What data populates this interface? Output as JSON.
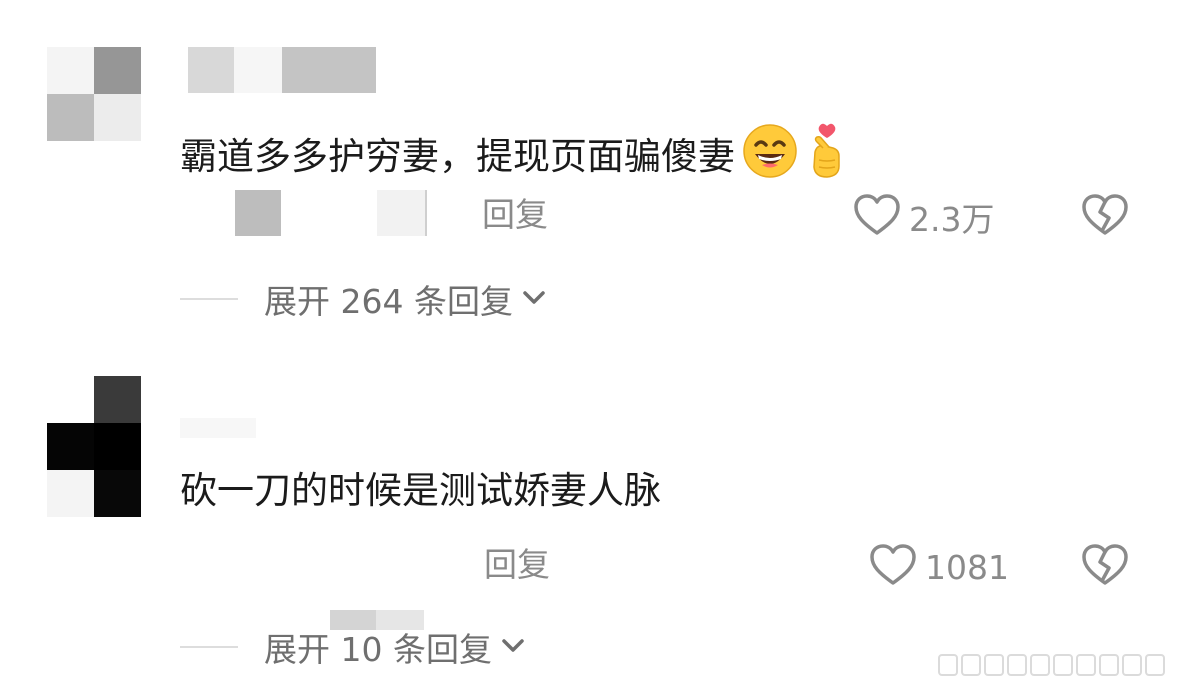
{
  "comments": [
    {
      "text": "霸道多多护穷妻，提现页面骗傻妻",
      "emojis": [
        "grinning-face-icon",
        "finger-heart-icon"
      ],
      "reply_label": "回复",
      "like_count": "2.3万",
      "expand_label": "展开 264 条回复"
    },
    {
      "text": "砍一刀的时候是测试娇妻人脉",
      "reply_label": "回复",
      "like_count": "1081",
      "expand_label": "展开 10 条回复"
    }
  ],
  "colors": {
    "text": "#1b1b1b",
    "muted": "#8a8a8a",
    "expand": "#6f6f6f",
    "heart_badge": "#f2566b",
    "emoji_yellow": "#ffca3a"
  }
}
